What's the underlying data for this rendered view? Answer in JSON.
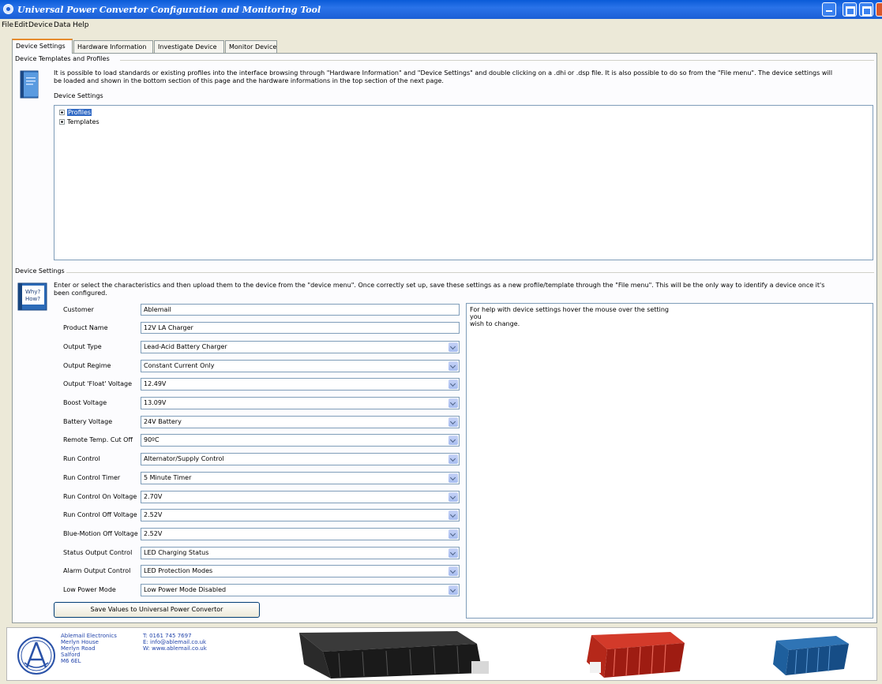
{
  "window": {
    "title": "Universal Power Convertor Configuration and Monitoring Tool"
  },
  "menu": [
    "File",
    "Edit",
    "Device",
    "Data",
    "Help"
  ],
  "tabs": [
    "Device Settings",
    "Hardware Information",
    "Investigate Device",
    "Monitor Device"
  ],
  "templates_section": {
    "heading": "Device Templates and Profiles",
    "description_line1": "It is possible to load standards or existing profiles into the interface browsing through \"Hardware Information\" and \"Device Settings\" and double clicking on a .dhi or .dsp file. It is also possible to do so from the \"File menu\". The device settings will",
    "description_line2": "be loaded and shown in the bottom section of this page and the hardware informations in the top section of the next page.",
    "tree_label": "Device Settings",
    "tree_items": [
      "Profiles",
      "Templates"
    ]
  },
  "settings_section": {
    "heading": "Device Settings",
    "icon_text": "Why? How?",
    "description_line1": "Enter or select the characteristics and then upload them to the device from the \"device menu\". Once correctly set up, save these settings as a new profile/template through the \"File menu\". This will be the only way to identify a device once it's",
    "description_line2": "been configured.",
    "fields": [
      {
        "label": "Customer",
        "value": "Ablemail"
      },
      {
        "label": "Product Name",
        "value": "12V LA Charger"
      },
      {
        "label": "Output Type",
        "value": "Lead-Acid Battery Charger"
      },
      {
        "label": "Output Regime",
        "value": "Constant Current Only"
      },
      {
        "label": "Output 'Float' Voltage",
        "value": "12.49V"
      },
      {
        "label": "Boost Voltage",
        "value": "13.09V"
      },
      {
        "label": "Battery Voltage",
        "value": "24V Battery"
      },
      {
        "label": "Remote Temp. Cut Off",
        "value": "90ºC"
      },
      {
        "label": "Run Control",
        "value": "Alternator/Supply Control"
      },
      {
        "label": "Run Control Timer",
        "value": "5 Minute Timer"
      },
      {
        "label": "Run Control On Voltage",
        "value": "2.70V"
      },
      {
        "label": "Run Control Off Voltage",
        "value": "2.52V"
      },
      {
        "label": "Blue-Motion Off Voltage",
        "value": "2.52V"
      },
      {
        "label": "Status Output Control",
        "value": "LED Charging Status"
      },
      {
        "label": "Alarm Output Control",
        "value": "LED Protection Modes"
      },
      {
        "label": "Low Power Mode",
        "value": "Low Power Mode Disabled"
      }
    ],
    "help_line1": "For help with device settings hover the mouse over the setting",
    "help_line2": "you",
    "help_line3": "wish to change.",
    "save_button": "Save Values to Universal Power Convertor"
  },
  "footer": {
    "company_lines": [
      "Ablemail Electronics",
      "Merlyn House",
      "Merlyn Road",
      "Salford",
      "M6 6EL"
    ],
    "contact_lines": [
      "T: 0161 745 7697",
      "E: info@ablemail.co.uk",
      "W: www.ablemail.co.uk"
    ]
  },
  "colors": {
    "titlebar": "#0a5bd8",
    "selection": "#316ac5",
    "active_tab": "#e68b2c"
  }
}
